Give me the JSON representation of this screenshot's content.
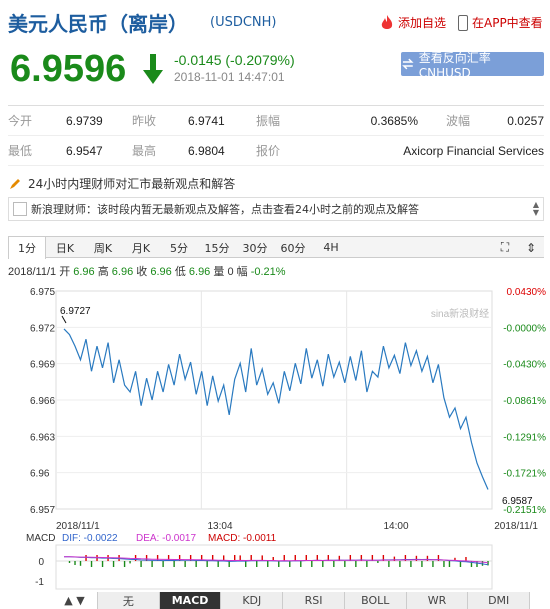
{
  "header": {
    "title": "美元人民币（离岸）",
    "code": "(USDCNH)",
    "add_fav": "添加自选",
    "app_view": "在APP中查看"
  },
  "quote": {
    "price": "6.9596",
    "change": "-0.0145 (-0.2079%)",
    "time": "2018-11-01 14:47:01",
    "reverse_button": "查看反向汇率 CNHUSD",
    "colors": {
      "down": "#1a8a1a",
      "up": "#d00000",
      "accent": "#1d5d9f"
    }
  },
  "stats": {
    "row1": [
      {
        "label": "今开",
        "value": "6.9739"
      },
      {
        "label": "昨收",
        "value": "6.9741"
      },
      {
        "label": "振幅",
        "value": "0.3685%"
      },
      {
        "label": "波幅",
        "value": "0.0257"
      }
    ],
    "row2": [
      {
        "label": "最低",
        "value": "6.9547"
      },
      {
        "label": "最高",
        "value": "6.9804"
      },
      {
        "label": "报价",
        "value": "Axicorp Financial Services"
      }
    ]
  },
  "news": {
    "heading": "24小时内理财师对汇市最新观点和解答",
    "box_text": "新浪理财师：该时段内暂无最新观点及解答，点击查看24小时之前的观点及解答"
  },
  "tabs": [
    "1分",
    "日K",
    "周K",
    "月K",
    "5分",
    "15分",
    "30分",
    "60分",
    "4H"
  ],
  "ohlc_line": {
    "date": "2018/11/1",
    "open_label": "开",
    "open": "6.96",
    "high_label": "高",
    "high": "6.96",
    "close_label": "收",
    "close": "6.96",
    "low_label": "低",
    "low": "6.96",
    "vol_label": "量",
    "vol": "0",
    "amp_label": "幅",
    "amp": "-0.21%"
  },
  "chart_data": {
    "type": "line",
    "y_ticks_left": [
      "6.975",
      "6.972",
      "6.969",
      "6.966",
      "6.963",
      "6.96",
      "6.957"
    ],
    "y_ticks_right": [
      "0.0430%",
      "-0.0000%",
      "-0.0430%",
      "-0.0861%",
      "-0.1291%",
      "-0.1721%",
      "-0.2151%"
    ],
    "x_labels": [
      "2018/11/1",
      "13:04",
      "14:00",
      "2018/11/1"
    ],
    "ylim": [
      6.957,
      6.976
    ],
    "annot_high": "6.9727",
    "annot_low": "6.9587",
    "watermark": "sina新浪财经",
    "macd": {
      "label": "MACD",
      "dif": "DIF: -0.0022",
      "dea": "DEA: -0.0017",
      "macd": "MACD: -0.0011"
    },
    "macd_ticks": [
      "0",
      "-1"
    ],
    "series_values": [
      6.9727,
      6.9722,
      6.9712,
      6.97,
      6.9718,
      6.969,
      6.9712,
      6.9693,
      6.9715,
      6.968,
      6.97,
      6.9678,
      6.9672,
      6.969,
      6.966,
      6.9684,
      6.9665,
      6.969,
      6.9672,
      6.9696,
      6.9678,
      6.9705,
      6.9683,
      6.9698,
      6.967,
      6.969,
      6.966,
      6.9686,
      6.9664,
      6.9678,
      6.9652,
      6.9683,
      6.9697,
      6.9672,
      6.971,
      6.9678,
      6.9692,
      6.967,
      6.968,
      6.9662,
      6.969,
      6.9673,
      6.9697,
      6.9679,
      6.971,
      6.9684,
      6.97,
      6.9677,
      6.9705,
      6.9685,
      6.9698,
      6.968,
      6.9703,
      6.9682,
      6.9708,
      6.9672,
      6.969,
      6.9685,
      6.9712,
      6.9693,
      6.9704,
      6.9688,
      6.9715,
      6.9695,
      6.9708,
      6.969,
      6.9703,
      6.968,
      6.9696,
      6.9667,
      6.965,
      6.9658,
      6.964,
      6.965,
      6.9628,
      6.961,
      6.9598,
      6.9587
    ]
  },
  "bottom_tabs": [
    "无",
    "MACD",
    "KDJ",
    "RSI",
    "BOLL",
    "WR",
    "DMI"
  ],
  "bottom_active": 1,
  "active_tab": 0
}
